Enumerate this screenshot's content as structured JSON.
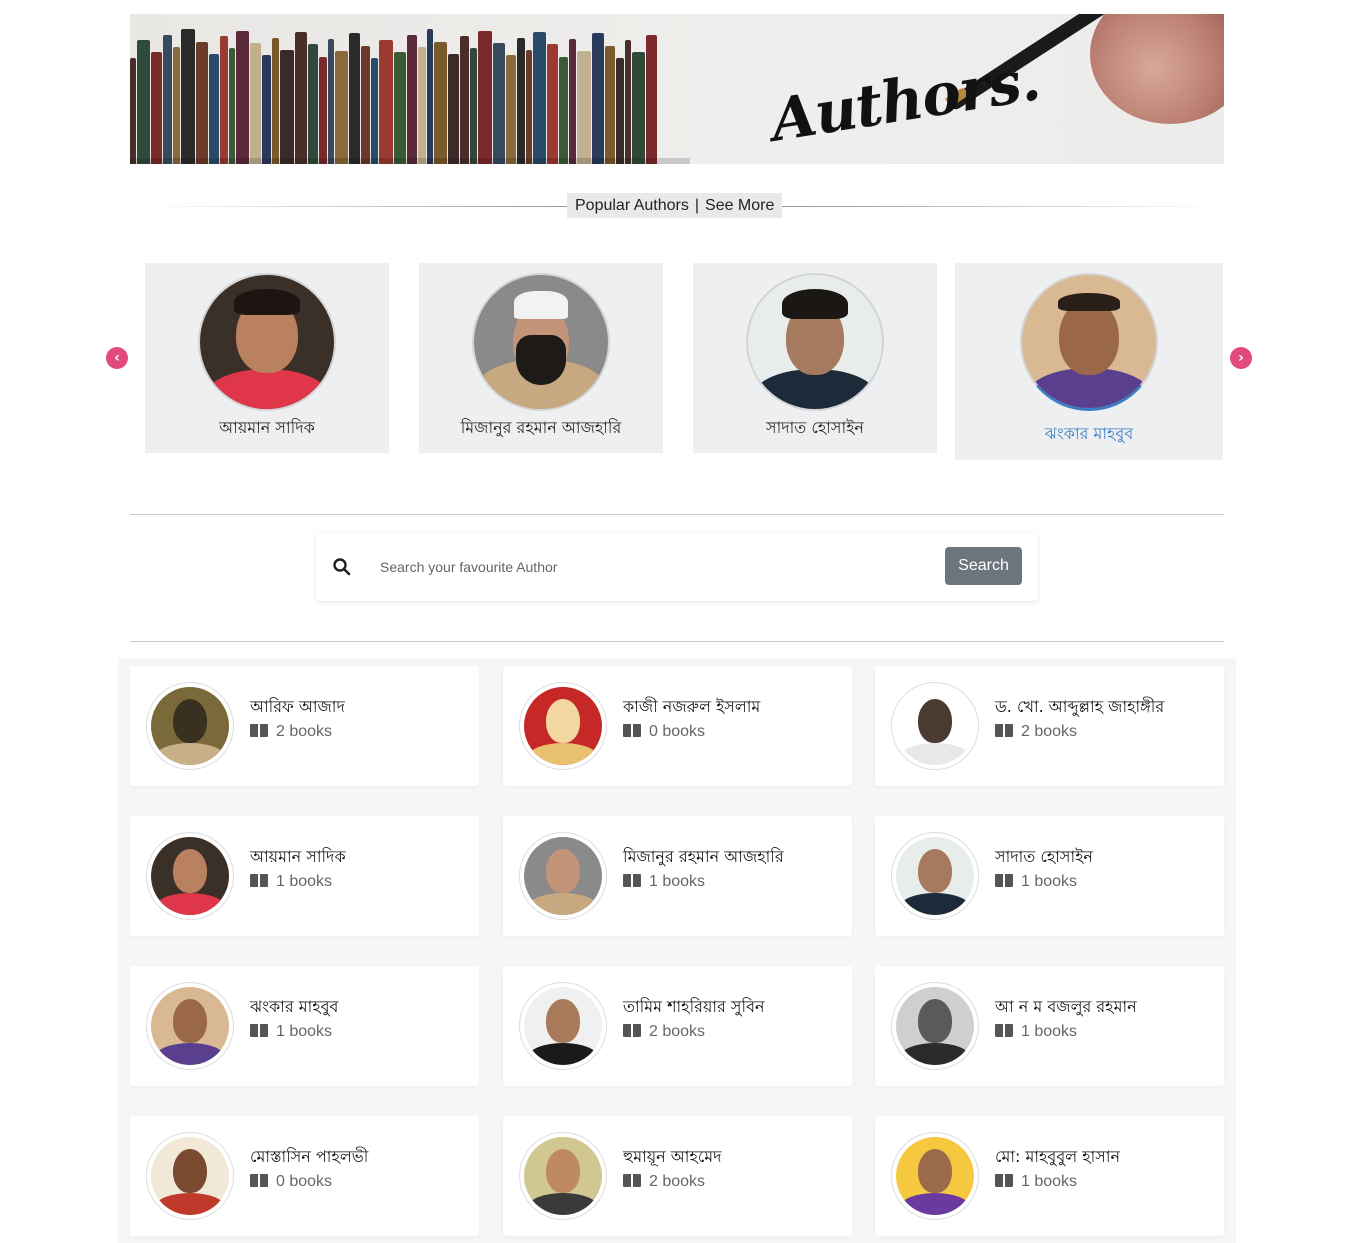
{
  "banner": {
    "title": "Authors."
  },
  "section": {
    "popular": "Popular Authors",
    "separator": "|",
    "see_more": "See More"
  },
  "carousel": {
    "prev_icon": "chevron-left-icon",
    "next_icon": "chevron-right-icon",
    "items": [
      {
        "name": "আয়মান সাদিক"
      },
      {
        "name": "মিজানুর রহমান আজহারি"
      },
      {
        "name": "সাদাত হোসাইন"
      },
      {
        "name": "ঝংকার মাহবুব"
      }
    ]
  },
  "search": {
    "placeholder": "Search your favourite Author",
    "button": "Search"
  },
  "authors": [
    {
      "name": "আরিফ আজাদ",
      "count": "2 books"
    },
    {
      "name": "কাজী নজরুল ইসলাম",
      "count": "0 books"
    },
    {
      "name": "ড. খো. আব্দুল্লাহ জাহাঙ্গীর",
      "count": "2 books"
    },
    {
      "name": "আয়মান সাদিক",
      "count": "1 books"
    },
    {
      "name": "মিজানুর রহমান আজহারি",
      "count": "1 books"
    },
    {
      "name": "সাদাত হোসাইন",
      "count": "1 books"
    },
    {
      "name": "ঝংকার মাহবুব",
      "count": "1 books"
    },
    {
      "name": "তামিম শাহরিয়ার সুবিন",
      "count": "2 books"
    },
    {
      "name": "আ ন ম বজলুর রহমান",
      "count": "1 books"
    },
    {
      "name": "মোস্তাসিন পাহলভী",
      "count": "0 books"
    },
    {
      "name": "হুমায়ূন আহমেদ",
      "count": "2 books"
    },
    {
      "name": "মো: মাহবুবুল হাসান",
      "count": "1 books"
    }
  ],
  "colors": {
    "accent": "#e34a7c",
    "active_link": "#3b7dc4",
    "button": "#6c757d"
  }
}
